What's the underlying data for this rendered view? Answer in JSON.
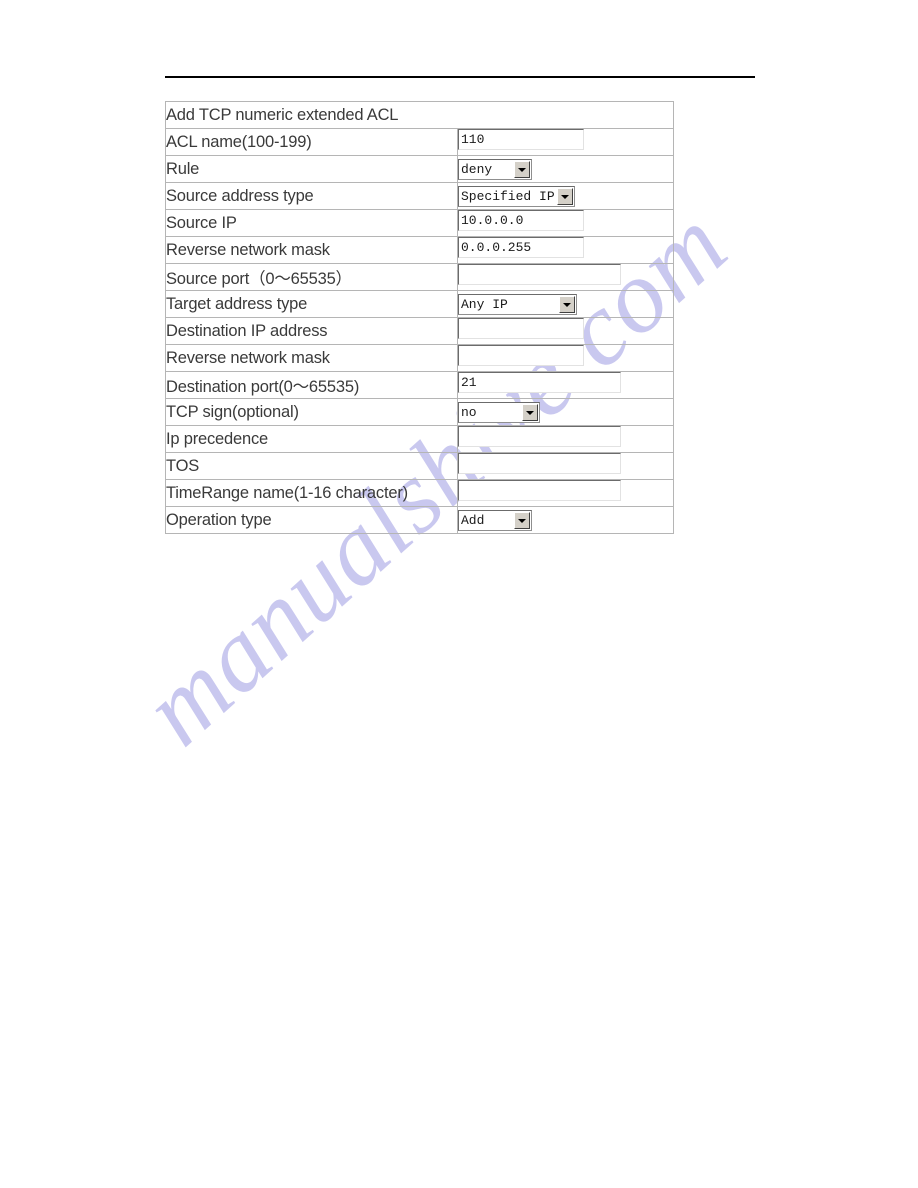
{
  "watermark": {
    "text": "manualshive.com"
  },
  "form": {
    "title": "Add TCP numeric extended ACL",
    "rows": [
      {
        "label": "ACL name(100-199)",
        "widget": "text",
        "value": "110",
        "size": "narrow"
      },
      {
        "label": "Rule",
        "widget": "select",
        "value": "deny",
        "size": "sm"
      },
      {
        "label": "Source address type",
        "widget": "select",
        "value": "Specified IP",
        "size": "lg"
      },
      {
        "label": "Source IP",
        "widget": "text",
        "value": "10.0.0.0",
        "size": "narrow"
      },
      {
        "label": "Reverse network mask",
        "widget": "text",
        "value": "0.0.0.255",
        "size": "narrow"
      },
      {
        "label": "Source port（0～65535）",
        "widget": "text",
        "value": "",
        "size": "wide"
      },
      {
        "label": "Target address type",
        "widget": "select",
        "value": "Any IP",
        "size": "xl"
      },
      {
        "label": "Destination IP address",
        "widget": "text",
        "value": "",
        "size": "narrow"
      },
      {
        "label": "Reverse network mask",
        "widget": "text",
        "value": "",
        "size": "narrow"
      },
      {
        "label": "Destination port(0～65535)",
        "widget": "text",
        "value": "21",
        "size": "wide"
      },
      {
        "label": "TCP sign(optional)",
        "widget": "select",
        "value": "no",
        "size": "md"
      },
      {
        "label": "Ip precedence",
        "widget": "text",
        "value": "",
        "size": "wide"
      },
      {
        "label": "TOS",
        "widget": "text",
        "value": "",
        "size": "wide"
      },
      {
        "label": "TimeRange name(1-16 character)",
        "widget": "text",
        "value": "",
        "size": "wide"
      },
      {
        "label": "Operation type",
        "widget": "select",
        "value": "Add",
        "size": "sm"
      }
    ]
  }
}
